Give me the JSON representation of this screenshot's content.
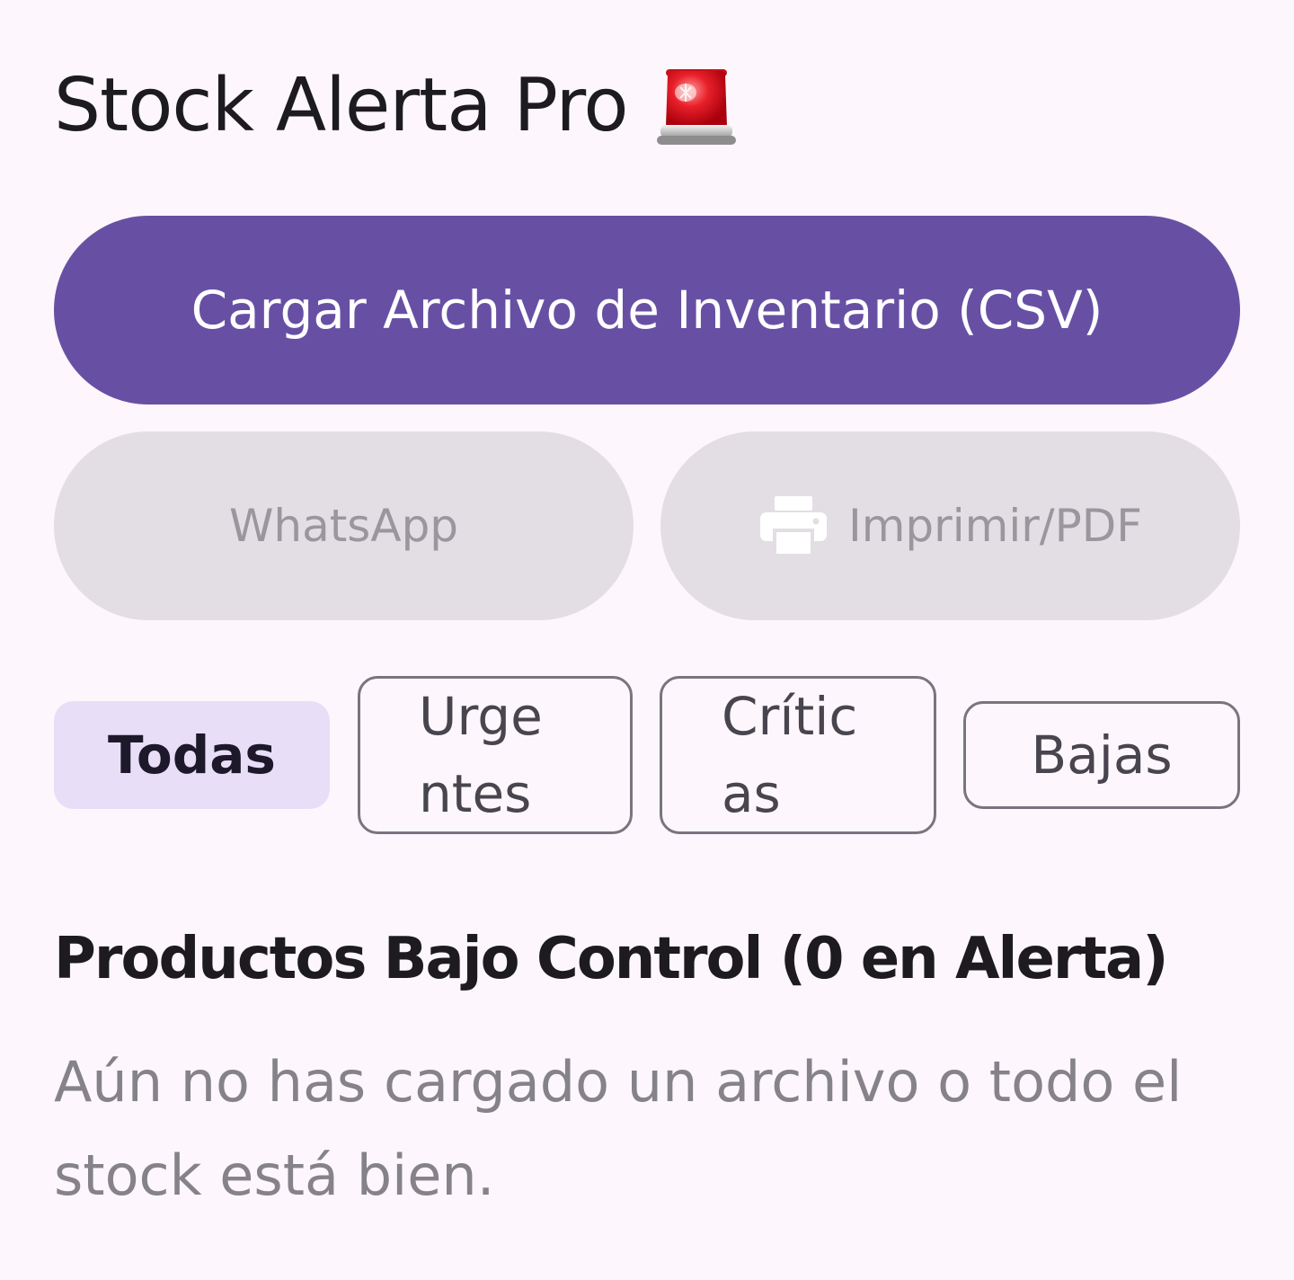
{
  "header": {
    "title": "Stock Alerta Pro",
    "icon": "siren-icon"
  },
  "actions": {
    "upload_label": "Cargar Archivo de Inventario (CSV)",
    "whatsapp_label": "WhatsApp",
    "print_label": "Imprimir/PDF",
    "print_icon": "printer-icon"
  },
  "filters": {
    "selected": "Todas",
    "chips": [
      "Todas",
      "Urgentes",
      "Críticas",
      "Bajas"
    ]
  },
  "products": {
    "title": "Productos Bajo Control (0 en Alerta)",
    "empty_message": "Aún no has cargado un archivo o todo el stock está bien."
  },
  "colors": {
    "background": "#fdf7fd",
    "primary": "#6750a4",
    "disabled_bg": "#e3dee4",
    "selected_chip": "#e8def8"
  }
}
